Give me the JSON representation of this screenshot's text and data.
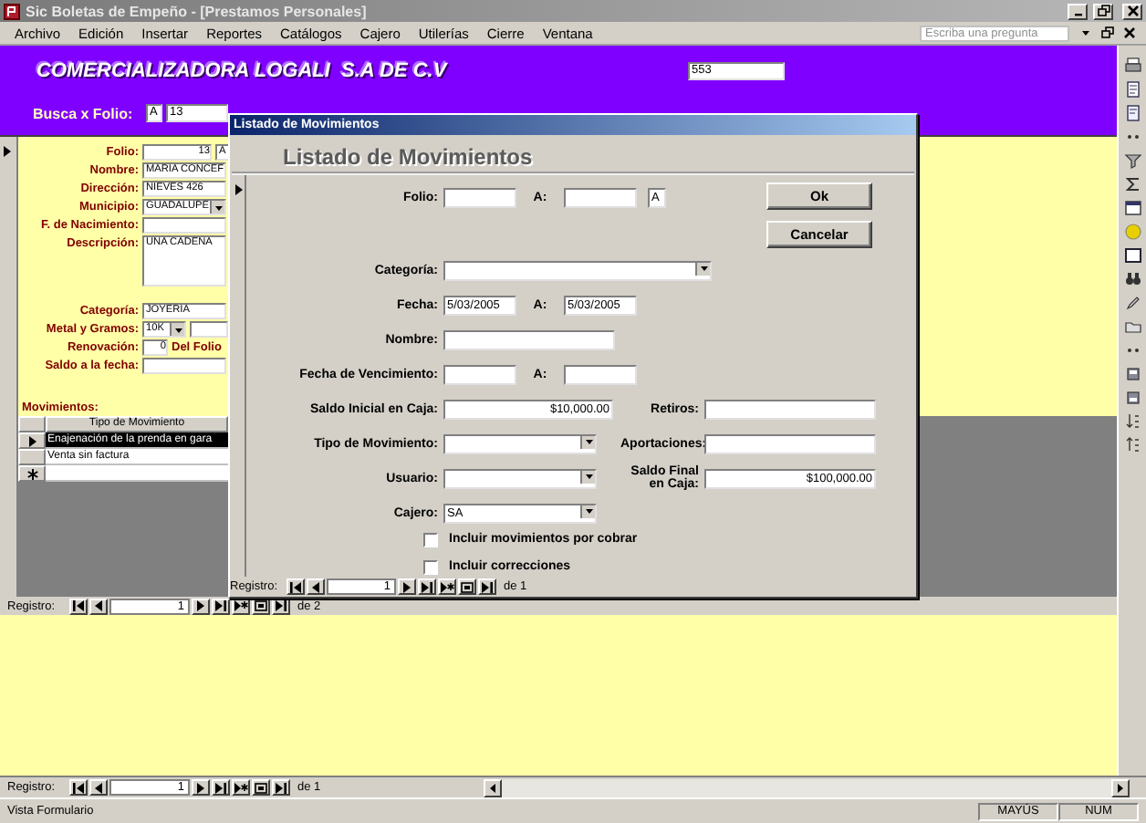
{
  "window": {
    "title": "Sic Boletas de Empeño - [Prestamos Personales]"
  },
  "menu": [
    "Archivo",
    "Edición",
    "Insertar",
    "Reportes",
    "Catálogos",
    "Cajero",
    "Utilerías",
    "Cierre",
    "Ventana"
  ],
  "help_box": {
    "placeholder": "Escriba una pregunta"
  },
  "header": {
    "company": "COMERCIALIZADORA LOGALI  S.A DE C.V",
    "number": "553",
    "search_label": "Busca x Folio:",
    "search_series": "A",
    "search_value": "13"
  },
  "form": {
    "fields": [
      {
        "kind": "split",
        "label": "Folio:",
        "value": "13",
        "suffix": "A"
      },
      {
        "kind": "text",
        "label": "Nombre:",
        "value": "MARIA CONCEF"
      },
      {
        "kind": "text",
        "label": "Dirección:",
        "value": "NIEVES 426"
      },
      {
        "kind": "combo",
        "label": "Municipio:",
        "value": "GUADALUPE"
      },
      {
        "kind": "text",
        "label": "F. de Nacimiento:"
      },
      {
        "kind": "memo",
        "label": "Descripción:",
        "value": "UNA CADENA"
      },
      {
        "kind": "text",
        "label": "Categoría:",
        "value": "JOYERIA"
      },
      {
        "kind": "combo_extra",
        "label": "Metal y Gramos:",
        "value": "10K"
      },
      {
        "kind": "with_note",
        "label": "Renovación:",
        "value": "0",
        "note": "Del Folio"
      },
      {
        "kind": "text",
        "label": "Saldo a la fecha:"
      }
    ]
  },
  "movements_label": "Movimientos:",
  "subform": {
    "columns": [
      "Tipo de Movimiento"
    ],
    "rows": [
      {
        "cells": [
          "Enajenación de la prenda en gara"
        ],
        "selected": true
      },
      {
        "cells": [
          "Venta sin factura"
        ],
        "selected": false
      }
    ],
    "nav": {
      "label": "Registro:",
      "current": "1",
      "total": "de 2"
    }
  },
  "dialog": {
    "title": "Listado de Movimientos",
    "heading": "Listado de Movimientos",
    "buttons": [
      {
        "label": "Ok"
      },
      {
        "label": "Cancelar"
      }
    ],
    "rows": [
      {
        "kind": "range",
        "label": "Folio:",
        "sep": "A:",
        "series": "A"
      },
      {
        "kind": "wide_combo",
        "label": "Categoría:"
      },
      {
        "kind": "range",
        "label": "Fecha:",
        "sep": "A:",
        "from": "5/03/2005",
        "to": "5/03/2005"
      },
      {
        "kind": "text",
        "label": "Nombre:"
      },
      {
        "kind": "range",
        "label": "Fecha de Vencimiento:",
        "sep": "A:"
      },
      {
        "kind": "money",
        "label": "Saldo Inicial en Caja:",
        "value": "$10,000.00",
        "side": {
          "label": "Retiros:"
        }
      },
      {
        "kind": "combo",
        "label": "Tipo de Movimiento:",
        "side": {
          "label": "Aportaciones:"
        }
      },
      {
        "kind": "combo",
        "label": "Usuario:",
        "side": {
          "label": "Saldo Final en Caja:",
          "value": "$100,000.00"
        }
      },
      {
        "kind": "combo",
        "label": "Cajero:",
        "value": "SA"
      }
    ],
    "checkboxes": [
      {
        "label": "Incluir movimientos por cobrar",
        "checked": false
      },
      {
        "label": "Incluir correcciones",
        "checked": false
      }
    ],
    "nav": {
      "label": "Registro:",
      "current": "1",
      "total": "de 1"
    }
  },
  "nav": {
    "label": "Registro:",
    "current": "1",
    "total": "de 1"
  },
  "status_bar": {
    "text": "Vista Formulario",
    "indicators": [
      "MAYÚS",
      "NUM"
    ]
  }
}
